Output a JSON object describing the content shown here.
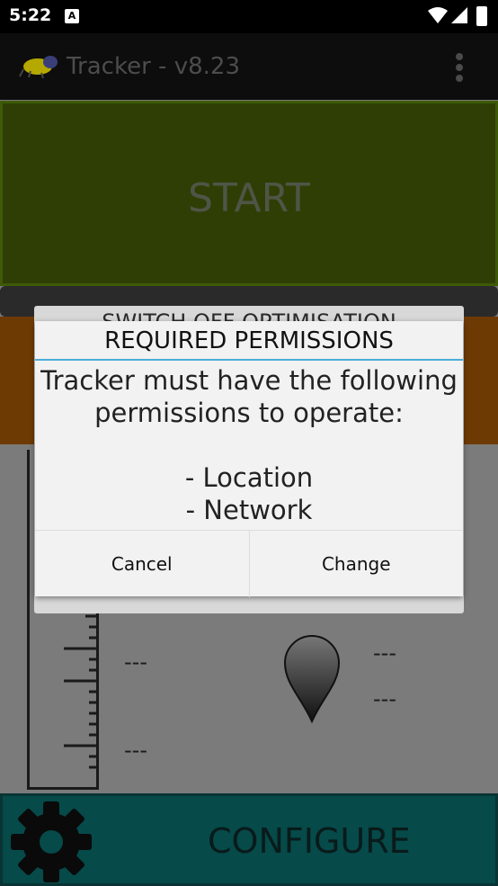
{
  "status_bar": {
    "time": "5:22",
    "notification_icon": "A"
  },
  "app_bar": {
    "title": "Tracker - v8.23"
  },
  "start_button": {
    "label": "START"
  },
  "optimisation_button": {
    "label": "SWITCH OFF OPTIMISATION"
  },
  "readouts": {
    "left_top": "---",
    "left_bottom": "---",
    "right_top": "---",
    "right_bottom": "---"
  },
  "configure_button": {
    "label": "CONFIGURE"
  },
  "dialog": {
    "title": "REQUIRED PERMISSIONS",
    "message": [
      "Tracker must have the following",
      "permissions to operate:",
      "",
      "- Location",
      "- Network"
    ],
    "cancel_label": "Cancel",
    "change_label": "Change"
  },
  "colors": {
    "start_bg": "#2f3e05",
    "orange_bg": "#6e3a04",
    "configure_bg": "#064a4a",
    "dialog_accent": "#4aaed8"
  }
}
